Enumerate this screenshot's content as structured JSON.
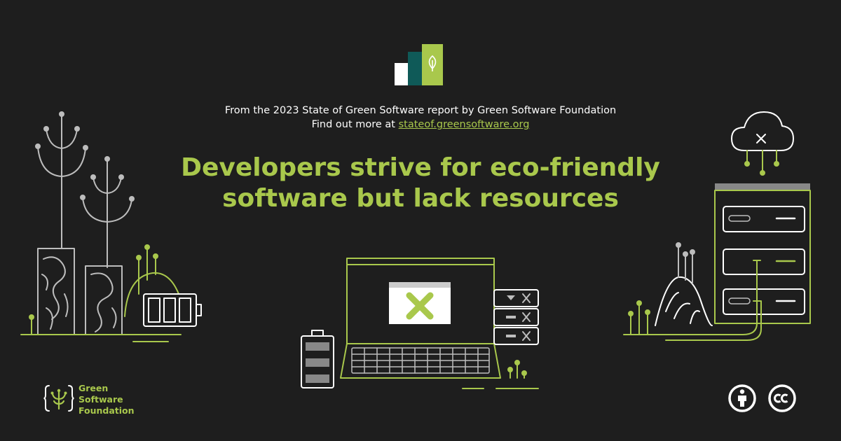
{
  "colors": {
    "background": "#1e1e1e",
    "accent": "#a9c84c",
    "line": "#bdbdbd",
    "teal": "#0f5a58",
    "white": "#ffffff"
  },
  "report_logo": {
    "icon": "leaf-icon"
  },
  "source": {
    "line1": "From the 2023 State of Green Software report by Green Software Foundation",
    "line2_prefix": "Find out more at ",
    "link_text": "stateof.greensoftware.org"
  },
  "headline": {
    "line1": "Developers strive for eco-friendly",
    "line2": "software but lack resources"
  },
  "footer": {
    "org_name": [
      "Green",
      "Software",
      "Foundation"
    ],
    "license_icons": [
      "attribution-icon",
      "creative-commons-icon"
    ]
  },
  "illustrations": {
    "left": [
      "tree-icon",
      "battery-icon",
      "hill-icon"
    ],
    "center": [
      "laptop-icon",
      "error-x-icon",
      "server-icon",
      "battery-icon"
    ],
    "right": [
      "cloud-icon",
      "server-rack-icon",
      "hill-icon"
    ]
  }
}
